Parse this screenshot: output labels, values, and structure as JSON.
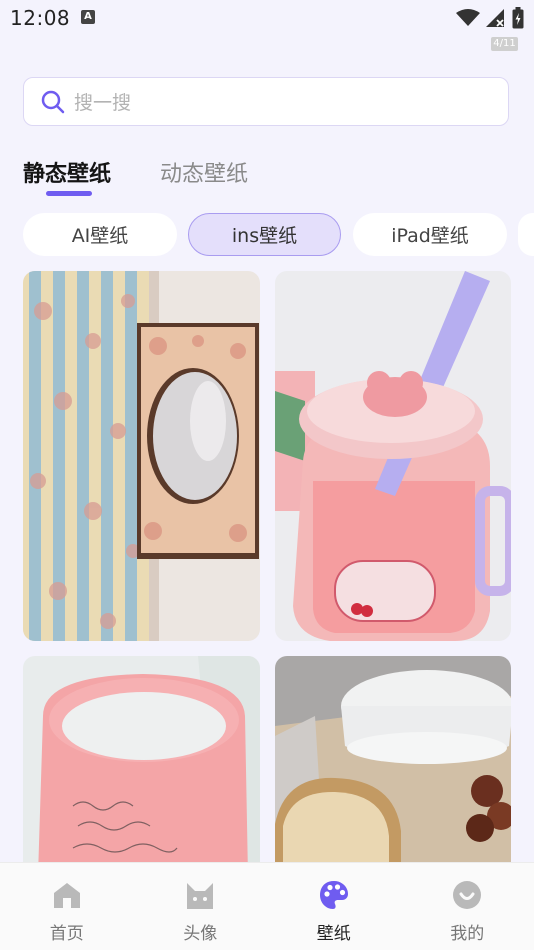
{
  "status_bar": {
    "time": "12:08",
    "page_counter": "4/11"
  },
  "search": {
    "placeholder": "搜一搜"
  },
  "tabs": [
    {
      "label": "静态壁纸",
      "active": true
    },
    {
      "label": "动态壁纸",
      "active": false
    }
  ],
  "categories": [
    {
      "label": "AI壁纸",
      "selected": false
    },
    {
      "label": "ins壁纸",
      "selected": true
    },
    {
      "label": "iPad壁纸",
      "selected": false
    }
  ],
  "wallpapers": [
    {
      "name": "floral-curtain-mirror"
    },
    {
      "name": "pink-jar-drink"
    },
    {
      "name": "pink-mug-milk"
    },
    {
      "name": "milk-and-bread"
    }
  ],
  "bottom_nav": [
    {
      "label": "首页",
      "icon": "home-icon",
      "active": false
    },
    {
      "label": "头像",
      "icon": "cat-face-icon",
      "active": false
    },
    {
      "label": "壁纸",
      "icon": "palette-icon",
      "active": true
    },
    {
      "label": "我的",
      "icon": "smile-icon",
      "active": false
    }
  ],
  "colors": {
    "accent": "#6f5cf0",
    "background": "#f4f3fd",
    "chip_selected_bg": "#e4dffb"
  }
}
